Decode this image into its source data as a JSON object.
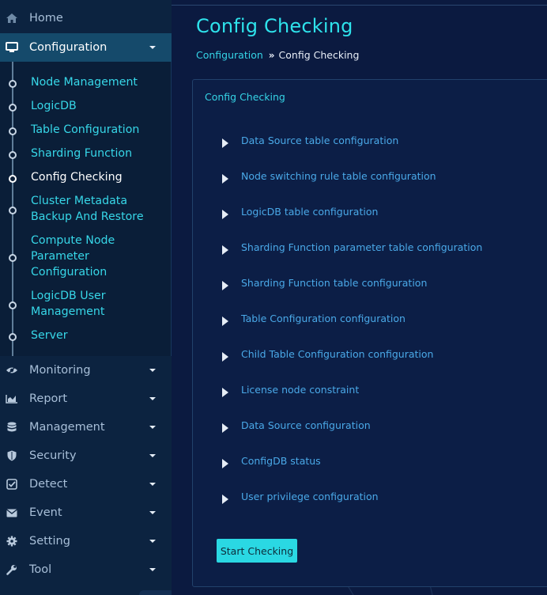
{
  "sidebar": {
    "top_items": [
      {
        "label": "Home",
        "icon": "home-icon"
      },
      {
        "label": "Configuration",
        "icon": "monitor-icon"
      }
    ],
    "config_submenu": [
      {
        "label": "Node Management"
      },
      {
        "label": "LogicDB"
      },
      {
        "label": "Table Configuration"
      },
      {
        "label": "Sharding Function"
      },
      {
        "label": "Config Checking"
      },
      {
        "label": "Cluster Metadata Backup And Restore"
      },
      {
        "label": "Compute Node Parameter Configuration"
      },
      {
        "label": "LogicDB User Management"
      },
      {
        "label": "Server"
      }
    ],
    "bottom_items": [
      {
        "label": "Monitoring",
        "icon": "eye-icon"
      },
      {
        "label": "Report",
        "icon": "area-chart-icon"
      },
      {
        "label": "Management",
        "icon": "database-icon"
      },
      {
        "label": "Security",
        "icon": "shield-icon"
      },
      {
        "label": "Detect",
        "icon": "check-square-icon"
      },
      {
        "label": "Event",
        "icon": "envelope-icon"
      },
      {
        "label": "Setting",
        "icon": "gear-icon"
      },
      {
        "label": "Tool",
        "icon": "wrench-icon"
      }
    ]
  },
  "page": {
    "title": "Config Checking",
    "breadcrumb": {
      "parent": "Configuration",
      "separator": "»",
      "current": "Config Checking"
    }
  },
  "panel": {
    "title": "Config Checking",
    "items": [
      "Data Source table configuration",
      "Node switching rule table configuration",
      "LogicDB table configuration",
      "Sharding Function parameter table configuration",
      "Sharding Function table configuration",
      "Table Configuration configuration",
      "Child Table Configuration configuration",
      "License node constraint",
      "Data Source configuration",
      "ConfigDB status",
      "User privilege configuration"
    ],
    "start_button": "Start Checking"
  },
  "colors": {
    "accent": "#2ee3ec",
    "link": "#4aa9e8",
    "active_bg": "#154a6b",
    "sidebar_bg": "#0c2340",
    "main_bg": "#0b1a40"
  }
}
